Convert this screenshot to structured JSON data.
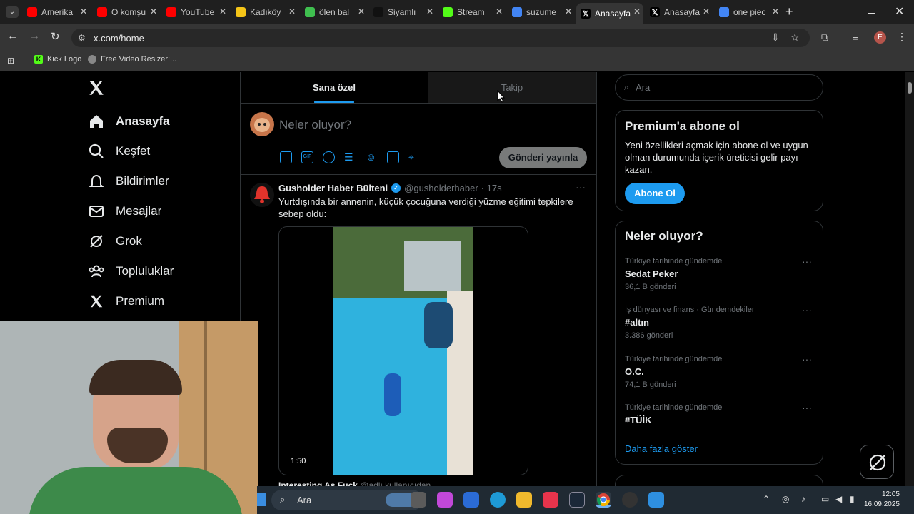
{
  "browser": {
    "tabs": [
      {
        "title": "Amerika",
        "favicon": "youtube-icon",
        "color": "#ff0000"
      },
      {
        "title": "O komşu",
        "favicon": "youtube-icon",
        "color": "#ff0000"
      },
      {
        "title": "YouTube",
        "favicon": "youtube-icon",
        "color": "#ff0000"
      },
      {
        "title": "Kadıköy",
        "favicon": "news-icon",
        "color": "#f5c518"
      },
      {
        "title": "ölen bal",
        "favicon": "drop-icon",
        "color": "#3fbf4f"
      },
      {
        "title": "Siyamlı",
        "favicon": "tiktok-icon",
        "color": "#111111"
      },
      {
        "title": "Stream",
        "favicon": "kick-icon",
        "color": "#53fc18"
      },
      {
        "title": "suzume",
        "favicon": "google-icon",
        "color": "#4285f4"
      },
      {
        "title": "Anasayfa",
        "favicon": "x-icon",
        "color": "#000000"
      },
      {
        "title": "Anasayfa",
        "favicon": "x-icon",
        "color": "#000000"
      },
      {
        "title": "one piec",
        "favicon": "google-icon",
        "color": "#4285f4"
      }
    ],
    "url": "x.com/home",
    "profile_initial": "E",
    "bookmarks": [
      {
        "label": "Kick Logo",
        "icon": "kick-icon"
      },
      {
        "label": "Free Video Resizer:...",
        "icon": "globe-icon"
      }
    ]
  },
  "x": {
    "nav": [
      {
        "label": "Anasayfa",
        "icon": "home-icon"
      },
      {
        "label": "Keşfet",
        "icon": "search-icon"
      },
      {
        "label": "Bildirimler",
        "icon": "bell-icon"
      },
      {
        "label": "Mesajlar",
        "icon": "mail-icon"
      },
      {
        "label": "Grok",
        "icon": "grok-icon"
      },
      {
        "label": "Topluluklar",
        "icon": "communities-icon"
      },
      {
        "label": "Premium",
        "icon": "x-logo-icon"
      }
    ],
    "tabs": {
      "for_you": "Sana özel",
      "following": "Takip"
    },
    "compose": {
      "placeholder": "Neler oluyor?",
      "post_button": "Gönderi yayınla"
    },
    "tweet": {
      "author": "Gusholder Haber Bülteni",
      "handle": "@gusholderhaber",
      "time": "· 17s",
      "text": "Yurtdışında bir annenin, küçük çocuğuna verdiği yüzme eğitimi tepkilere sebep oldu:",
      "video_duration": "1:50",
      "next_author": "Interesting As Fuck",
      "next_handle": "@adlı kullanıcıdan"
    },
    "search_placeholder": "Ara",
    "premium": {
      "title": "Premium'a abone ol",
      "text": "Yeni özellikleri açmak için abone ol ve uygun olman durumunda içerik üreticisi gelir payı kazan.",
      "button": "Abone Ol"
    },
    "trends_title": "Neler oluyor?",
    "trends": [
      {
        "meta": "Türkiye tarihinde gündemde",
        "name": "Sedat Peker",
        "count": "36,1 B gönderi"
      },
      {
        "meta": "İş dünyası ve finans · Gündemdekiler",
        "name": "#altın",
        "count": "3.386 gönderi"
      },
      {
        "meta": "Türkiye tarihinde gündemde",
        "name": "O.C.",
        "count": "74,1 B gönderi"
      },
      {
        "meta": "Türkiye tarihinde gündemde",
        "name": "#TÜİK",
        "count": ""
      }
    ],
    "show_more": "Daha fazla göster"
  },
  "taskbar": {
    "search_placeholder": "Ara",
    "time": "12:05",
    "date": "16.09.2025"
  },
  "colors": {
    "accent": "#1d9bf0",
    "background": "#000000",
    "border": "#2f3336",
    "muted": "#71767b"
  }
}
